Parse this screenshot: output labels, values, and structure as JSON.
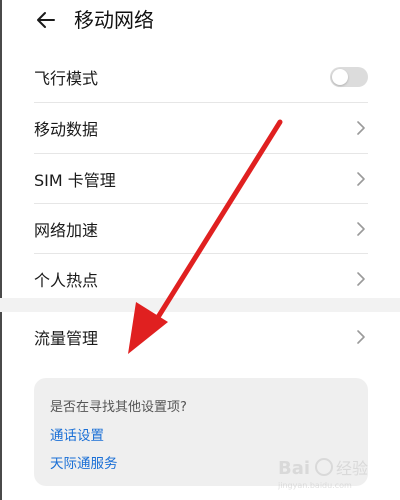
{
  "header": {
    "title": "移动网络",
    "back_icon": "arrow-left-icon"
  },
  "rows": [
    {
      "label": "飞行模式",
      "control": "toggle",
      "toggle_on": false
    },
    {
      "label": "移动数据",
      "control": "chevron"
    },
    {
      "label": "SIM 卡管理",
      "control": "chevron"
    },
    {
      "label": "网络加速",
      "control": "chevron"
    },
    {
      "label": "个人热点",
      "control": "chevron"
    },
    {
      "label": "流量管理",
      "control": "chevron"
    }
  ],
  "suggestions": {
    "question": "是否在寻找其他设置项?",
    "links": [
      "通话设置",
      "天际通服务"
    ]
  },
  "colors": {
    "link": "#1a6fd6",
    "annotation_arrow": "#e02020",
    "toggle_off": "#dcdcdc",
    "card_bg": "#efefef"
  },
  "watermark": {
    "text": "Bai 经验",
    "sub": "jingyan.baidu.com"
  }
}
